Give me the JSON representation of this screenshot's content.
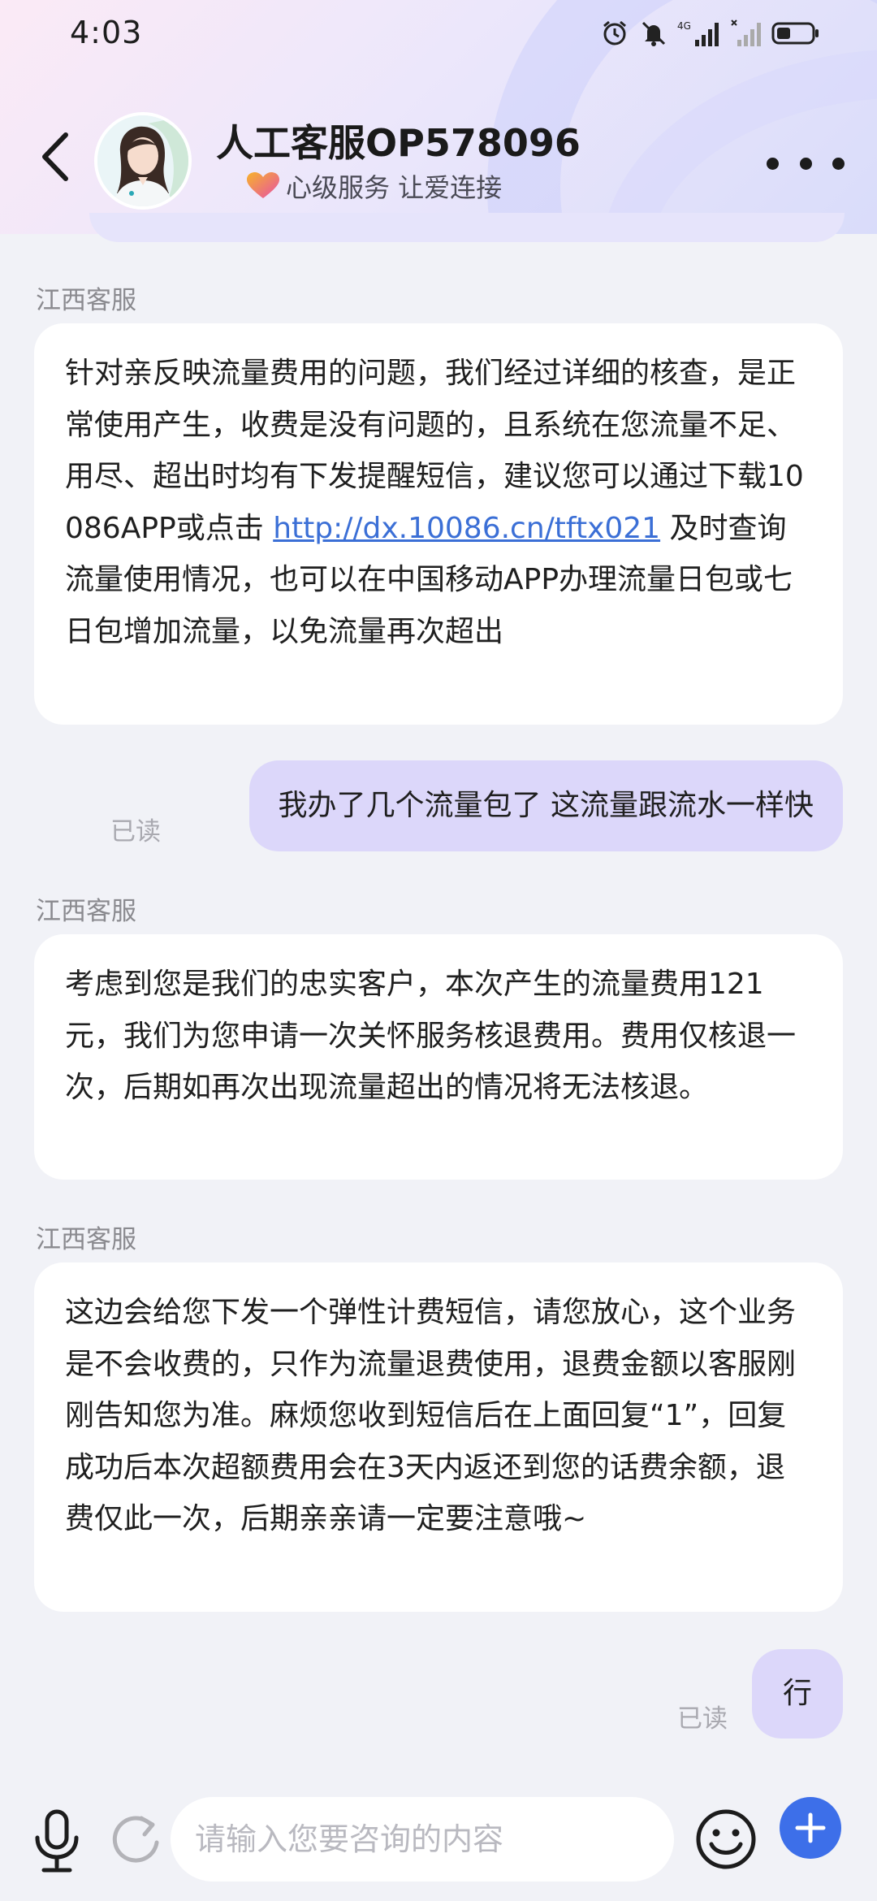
{
  "status_bar": {
    "time": "4:03",
    "network": "4G",
    "icons": [
      "alarm-icon",
      "mute-icon",
      "signal-4g-icon",
      "signal-icon",
      "battery-icon"
    ]
  },
  "header": {
    "title": "人工客服OP578096",
    "subtitle": "心级服务 让爱连接",
    "icons": [
      "back-icon",
      "heart-icon",
      "more-icon"
    ]
  },
  "messages": [
    {
      "side": "in",
      "sender": "江西客服",
      "text_before": "针对亲反映流量费用的问题，我们经过详细的核查，是正常使用产生，收费是没有问题的，且系统在您流量不足、用尽、超出时均有下发提醒短信，建议您可以通过下载10086APP或点击 ",
      "link": "http://dx.10086.cn/tftx021",
      "text_after": " 及时查询流量使用情况，也可以在中国移动APP办理流量日包或七日包增加流量，以免流量再次超出"
    },
    {
      "side": "out",
      "text": "我办了几个流量包了 这流量跟流水一样快",
      "status": "已读"
    },
    {
      "side": "in",
      "sender": "江西客服",
      "text": "考虑到您是我们的忠实客户，本次产生的流量费用121元，我们为您申请一次关怀服务核退费用。费用仅核退一次，后期如再次出现流量超出的情况将无法核退。"
    },
    {
      "side": "in",
      "sender": "江西客服",
      "text": "这边会给您下发一个弹性计费短信，请您放心，这个业务是不会收费的，只作为流量退费使用，退费金额以客服刚刚告知您为准。麻烦您收到短信后在上面回复“1”，回复成功后本次超额费用会在3天内返还到您的话费余额，退费仅此一次，后期亲亲请一定要注意哦~"
    },
    {
      "side": "out",
      "text": "行",
      "status": "已读"
    }
  ],
  "input_bar": {
    "placeholder": "请输入您要咨询的内容",
    "icons": [
      "microphone-icon",
      "refresh-icon",
      "emoji-icon",
      "plus-icon"
    ]
  },
  "colors": {
    "accent": "#3d6fe9",
    "outgoing_bubble": "#dcd7fa",
    "link": "#3b6fd6",
    "background": "#f1f2f7"
  }
}
